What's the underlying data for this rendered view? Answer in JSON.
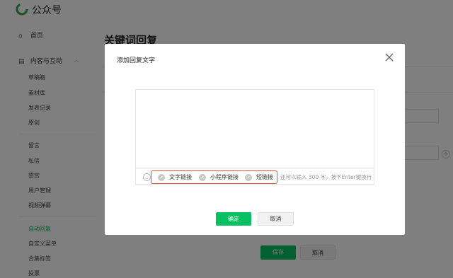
{
  "app": {
    "title": "公众号",
    "brand_color": "#07c160"
  },
  "sidebar": {
    "home": {
      "icon": "home-icon",
      "label": "首页"
    },
    "group": {
      "icon": "document-icon",
      "label": "内容与互动"
    },
    "items": [
      {
        "label": "草稿箱"
      },
      {
        "label": "素材库"
      },
      {
        "label": "发表记录"
      },
      {
        "label": "原创"
      },
      {
        "label": "留言"
      },
      {
        "label": "私信"
      },
      {
        "label": "赞赏"
      },
      {
        "label": "用户管理"
      },
      {
        "label": "视频弹幕"
      },
      {
        "label": "自动回复",
        "active": true
      },
      {
        "label": "自定义菜单"
      },
      {
        "label": "合集标签"
      },
      {
        "label": "投票"
      }
    ]
  },
  "main": {
    "page_title": "关键词回复",
    "save_label": "保存",
    "cancel_label": "取消"
  },
  "dialog": {
    "title": "添加回复文字",
    "close_icon": "close-icon",
    "editor_value": "",
    "toolbar": {
      "emoji_icon": "emoji-icon",
      "links": [
        {
          "icon": "link-icon",
          "label": "文字链接"
        },
        {
          "icon": "link-icon",
          "label": "小程序链接"
        },
        {
          "icon": "link-icon",
          "label": "短链接"
        }
      ],
      "hint": "还可以输入 300 字，按下Enter键换行",
      "highlight_color": "#e24a3b"
    },
    "confirm_label": "确定",
    "cancel_label": "取消"
  }
}
